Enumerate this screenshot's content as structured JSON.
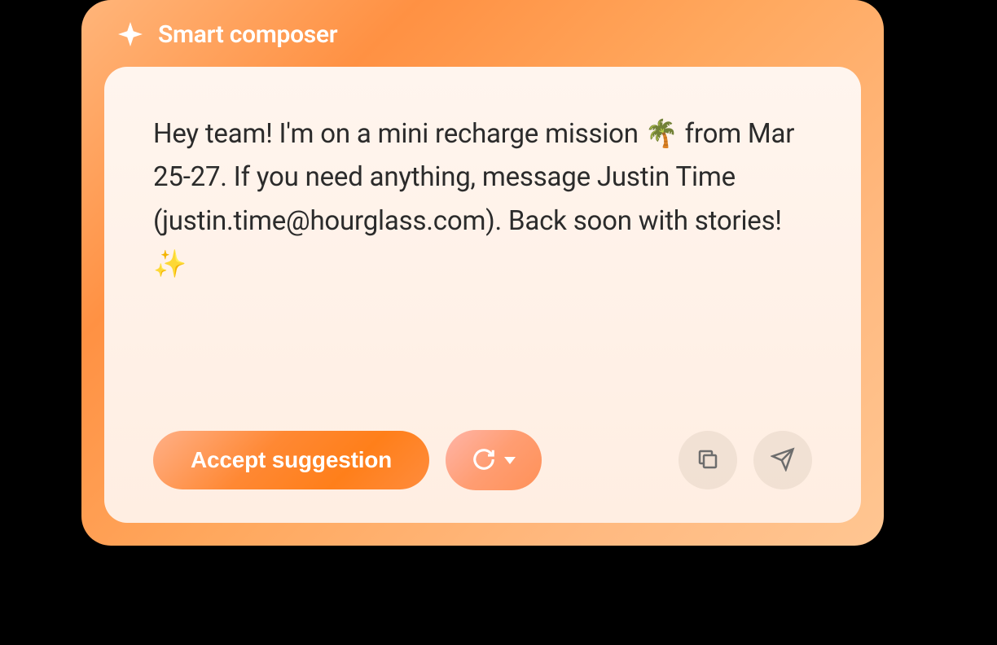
{
  "header": {
    "title": "Smart composer"
  },
  "message": {
    "text": "Hey team! I'm on a mini recharge mission 🌴 from Mar 25-27. If you need anything, message Justin Time (justin.time@hourglass.com). Back soon with stories! ✨"
  },
  "actions": {
    "accept_label": "Accept suggestion"
  }
}
